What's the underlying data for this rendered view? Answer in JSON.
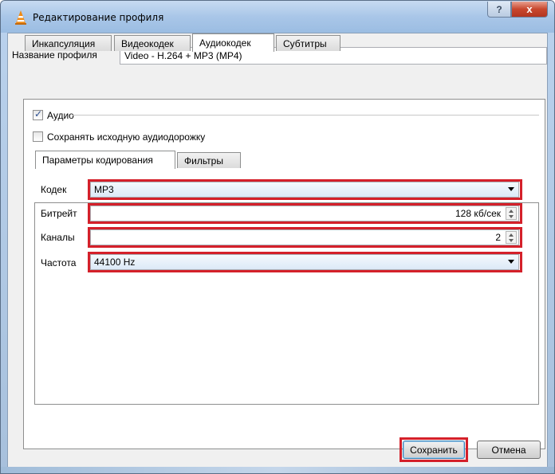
{
  "window": {
    "title": "Редактирование профиля",
    "help_label": "?",
    "close_label": "x"
  },
  "profile": {
    "name_label": "Название профиля",
    "name_value": "Video - H.264 + MP3 (MP4)"
  },
  "tabs": [
    {
      "label": "Инкапсуляция",
      "active": false
    },
    {
      "label": "Видеокодек",
      "active": false
    },
    {
      "label": "Аудиокодек",
      "active": true
    },
    {
      "label": "Субтитры",
      "active": false
    }
  ],
  "audio": {
    "enable_label": "Аудио",
    "enable_checked": true,
    "keep_label": "Сохранять исходную аудиодорожку",
    "keep_checked": false
  },
  "subtabs": [
    {
      "label": "Параметры кодирования",
      "active": true
    },
    {
      "label": "Фильтры",
      "active": false
    }
  ],
  "encoding": {
    "codec_label": "Кодек",
    "codec_value": "MP3",
    "bitrate_label": "Битрейт",
    "bitrate_value": "128 кб/сек",
    "channels_label": "Каналы",
    "channels_value": "2",
    "samplerate_label": "Частота",
    "samplerate_value": "44100 Hz"
  },
  "buttons": {
    "save_label": "Сохранить",
    "cancel_label": "Отмена"
  },
  "colors": {
    "highlight": "#d4202a",
    "title_gradient": "#a9c6e8"
  }
}
